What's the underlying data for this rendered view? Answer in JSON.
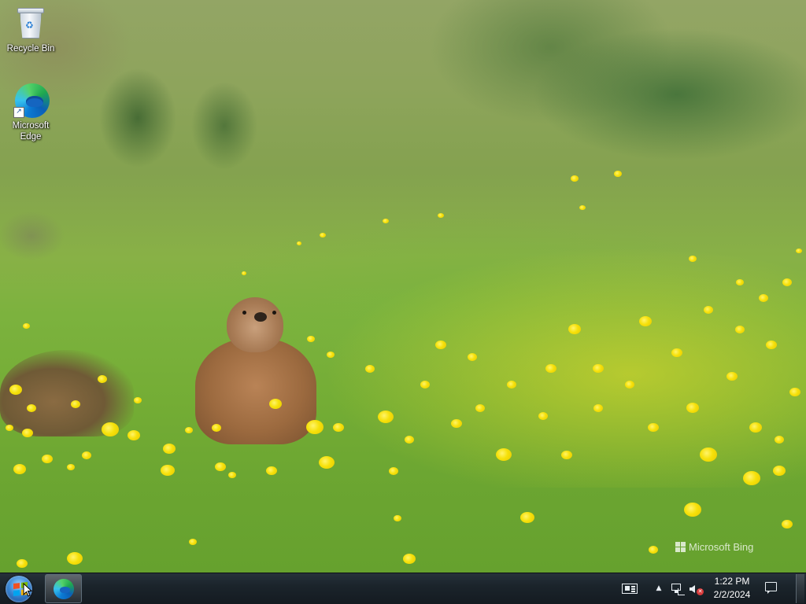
{
  "desktop": {
    "icons": [
      {
        "label": "Recycle Bin",
        "icon": "recycle-bin-icon"
      },
      {
        "label": "Microsoft\nEdge",
        "icon": "edge-icon"
      }
    ],
    "wallpaper_credit": "Microsoft Bing"
  },
  "taskbar": {
    "start_icon": "windows-start-orb",
    "pinned": [
      {
        "name": "Microsoft Edge",
        "icon": "edge-icon",
        "active": true
      }
    ],
    "tray": {
      "icons": [
        "news-and-interests-icon",
        "show-hidden-icons-chevron",
        "network-icon",
        "volume-muted-icon"
      ]
    },
    "clock": {
      "time": "1:22 PM",
      "date": "2/2/2024"
    },
    "action_center_icon": "notification-icon"
  },
  "colors": {
    "taskbar": "#1b242b",
    "text": "#ffffff"
  }
}
